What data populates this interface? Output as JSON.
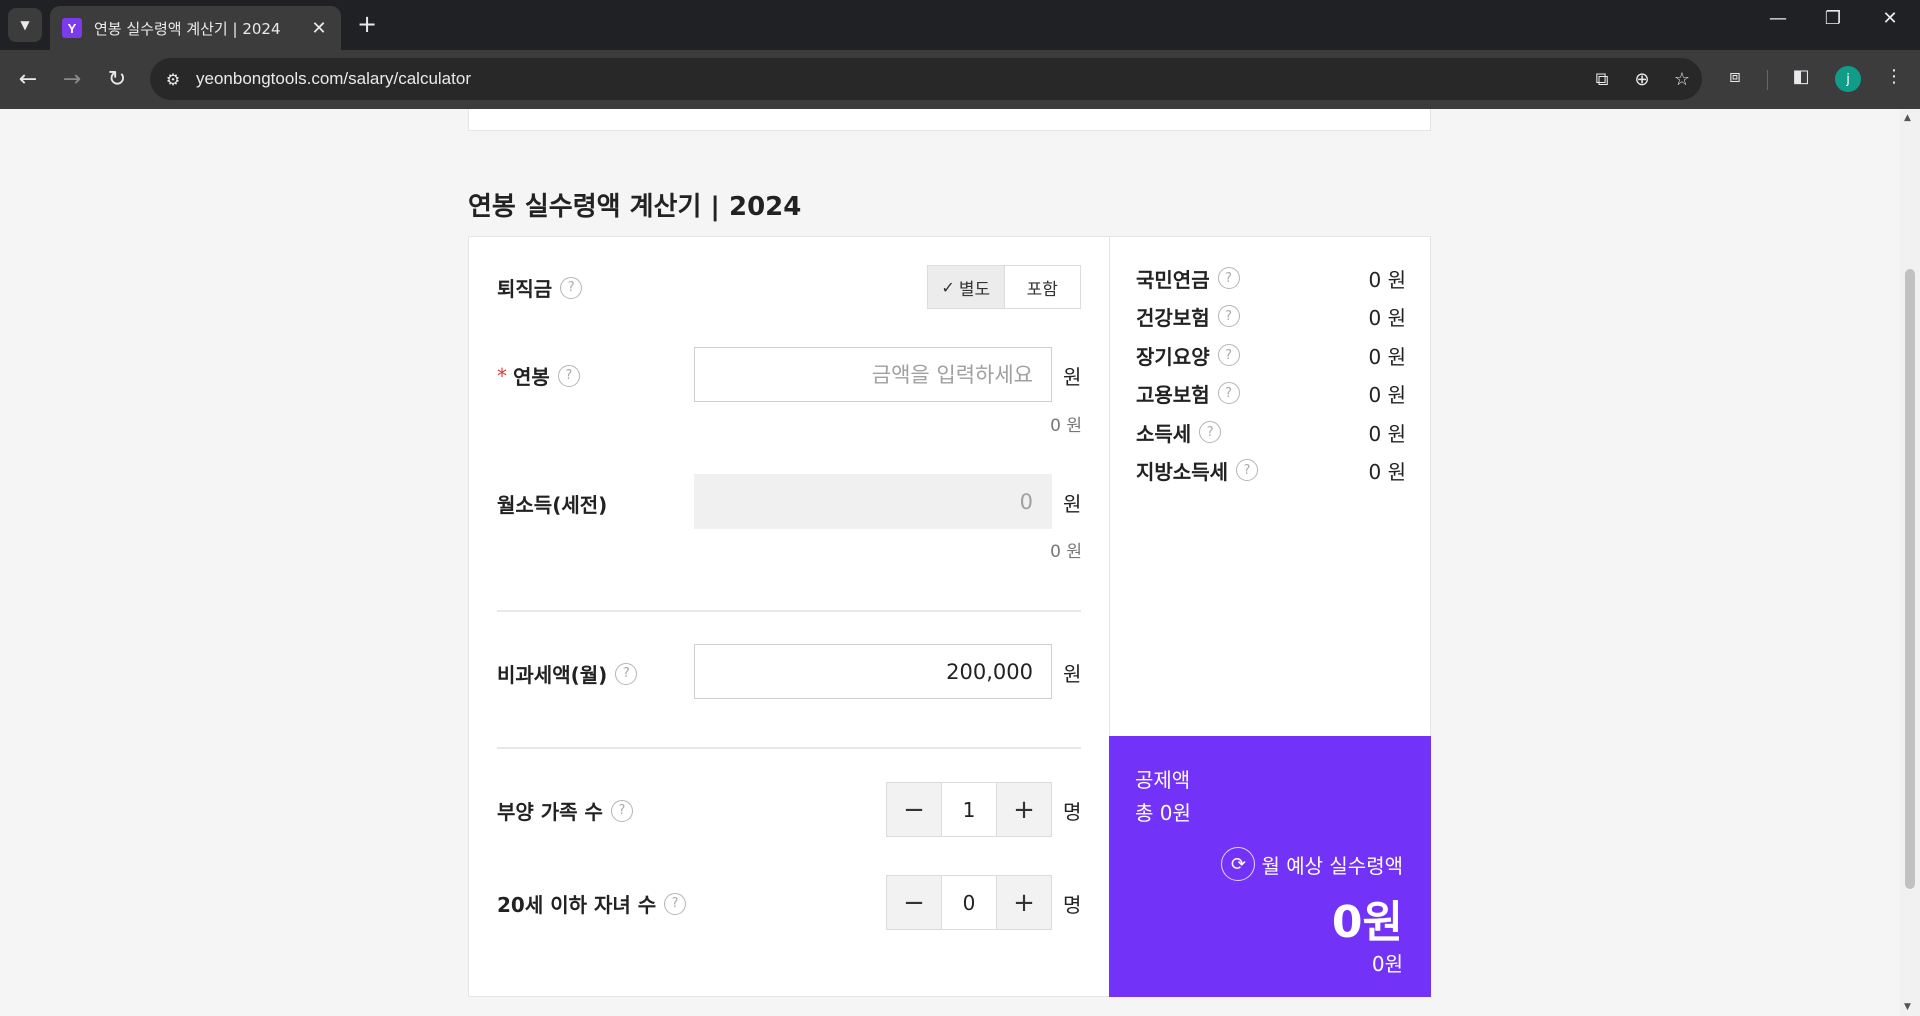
{
  "browser": {
    "tab_title": "연봉 실수령액 계산기 | 2024",
    "favicon_letter": "Y",
    "url": "yeonbongtools.com/salary/calculator",
    "profile_initial": "j"
  },
  "page": {
    "title": "연봉 실수령액 계산기 | 2024"
  },
  "form": {
    "severance": {
      "label": "퇴직금",
      "options": [
        "별도",
        "포함"
      ],
      "selected": "별도"
    },
    "annual_salary": {
      "required_mark": "*",
      "label": "연봉",
      "value": "",
      "placeholder": "금액을 입력하세요",
      "unit": "원",
      "sub_amount": "0 원"
    },
    "monthly_income": {
      "label": "월소득(세전)",
      "value": "",
      "placeholder": "0",
      "unit": "원",
      "sub_amount": "0 원"
    },
    "nontaxable": {
      "label": "비과세액(월)",
      "value": "200,000",
      "unit": "원"
    },
    "dependents": {
      "label": "부양 가족 수",
      "value": "1",
      "unit": "명",
      "minus": "−",
      "plus": "+"
    },
    "children": {
      "label": "20세 이하 자녀 수",
      "value": "0",
      "unit": "명",
      "minus": "−",
      "plus": "+"
    }
  },
  "deductions": [
    {
      "name": "국민연금",
      "value": "0 원"
    },
    {
      "name": "건강보험",
      "value": "0 원"
    },
    {
      "name": "장기요양",
      "value": "0 원"
    },
    {
      "name": "고용보험",
      "value": "0 원"
    },
    {
      "name": "소득세",
      "value": "0 원"
    },
    {
      "name": "지방소득세",
      "value": "0 원"
    }
  ],
  "result": {
    "deduction_label": "공제액",
    "deduction_total": "총 0원",
    "monthly_label": "월 예상 실수령액",
    "monthly_amount": "0원",
    "annual_amount": "0원",
    "accent_color": "#7332f7"
  },
  "help_glyph": "?",
  "checkmark": "✓"
}
